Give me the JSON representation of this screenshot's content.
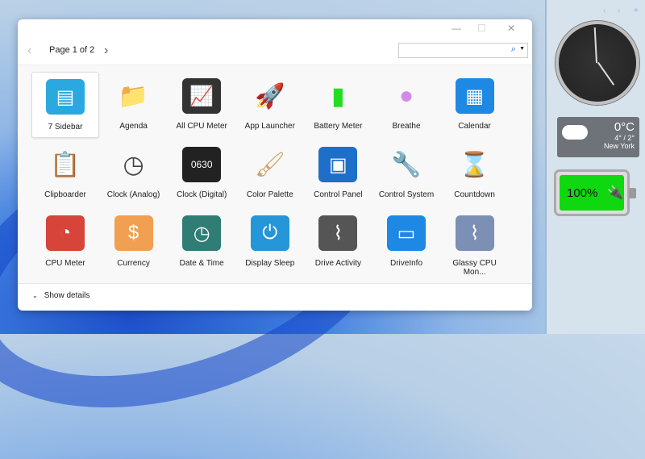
{
  "window": {
    "page_label": "Page 1 of 2",
    "search_value": "",
    "minimize": "—",
    "maximize": "☐",
    "close": "✕",
    "prev": "‹",
    "next": "›",
    "show_details": "Show details"
  },
  "gadgets": [
    {
      "label": "7 Sidebar",
      "icon": "sidebar-icon",
      "color": "#2aa8e0"
    },
    {
      "label": "Agenda",
      "icon": "folder-icon",
      "color": "#f7c948"
    },
    {
      "label": "All CPU Meter",
      "icon": "monitor-graph-icon",
      "color": "#333333"
    },
    {
      "label": "App Launcher",
      "icon": "rocket-icon",
      "color": "#e84a5f"
    },
    {
      "label": "Battery Meter",
      "icon": "battery-icon",
      "color": "#22dd22"
    },
    {
      "label": "Breathe",
      "icon": "bubbles-icon",
      "color": "#d58ae8"
    },
    {
      "label": "Calendar",
      "icon": "calendar-icon",
      "color": "#1e88e5"
    },
    {
      "label": "Clipboarder",
      "icon": "clipboard-icon",
      "color": "#7a4a2a"
    },
    {
      "label": "Clock (Analog)",
      "icon": "analog-clock-icon",
      "color": "#444444"
    },
    {
      "label": "Clock (Digital)",
      "icon": "digital-clock-icon",
      "color": "#222222"
    },
    {
      "label": "Color Palette",
      "icon": "brush-icon",
      "color": "#c8a46a"
    },
    {
      "label": "Control Panel",
      "icon": "control-panel-icon",
      "color": "#1e6fc9"
    },
    {
      "label": "Control System",
      "icon": "wrench-icon",
      "color": "#7b8a99"
    },
    {
      "label": "Countdown",
      "icon": "hourglass-icon",
      "color": "#c79a3e"
    },
    {
      "label": "CPU Meter",
      "icon": "gauge-icon",
      "color": "#d6443a"
    },
    {
      "label": "Currency",
      "icon": "money-bag-icon",
      "color": "#f0a050"
    },
    {
      "label": "Date & Time",
      "icon": "teal-clock-icon",
      "color": "#2f7d74"
    },
    {
      "label": "Display Sleep",
      "icon": "display-power-icon",
      "color": "#2596d8"
    },
    {
      "label": "Drive Activity",
      "icon": "drive-activity-icon",
      "color": "#555555"
    },
    {
      "label": "DriveInfo",
      "icon": "drive-info-icon",
      "color": "#1e88e5"
    },
    {
      "label": "Glassy CPU Mon...",
      "icon": "glassy-cpu-icon",
      "color": "#7c8fb5"
    }
  ],
  "sidebar": {
    "weather": {
      "temp": "0°C",
      "range": "4° / 2°",
      "city": "New York"
    },
    "battery": {
      "percent": "100%",
      "level": 100
    },
    "controls": [
      "‹",
      "›",
      "+"
    ]
  }
}
